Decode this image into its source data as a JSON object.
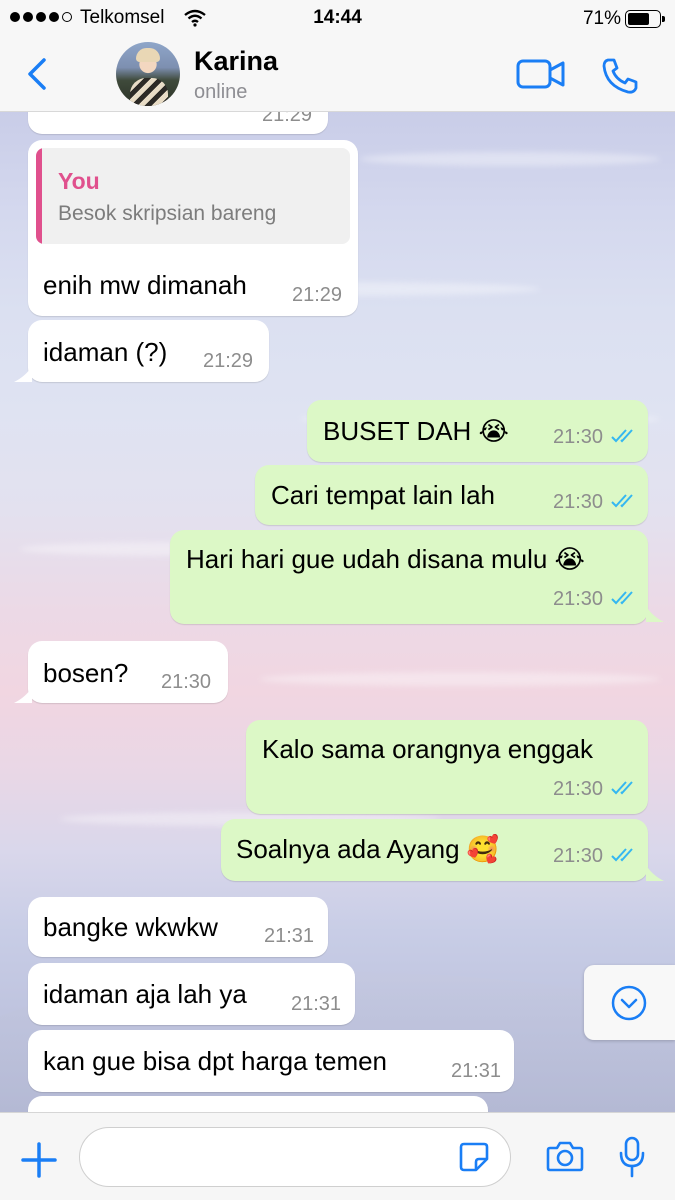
{
  "status_bar": {
    "carrier": "Telkomsel",
    "time": "14:44",
    "battery": "71%"
  },
  "header": {
    "contact_name": "Karina",
    "contact_status": "online",
    "icons": [
      "back-chevron-icon",
      "video-camera-icon",
      "phone-icon"
    ]
  },
  "messages": [
    {
      "dir": "in",
      "time": "21:29",
      "partial": true
    },
    {
      "dir": "in",
      "quote_author": "You",
      "quote_text": "Besok skripsian bareng",
      "text": "enih mw dimanah",
      "time": "21:29"
    },
    {
      "dir": "in",
      "text": "idaman (?)",
      "time": "21:29"
    },
    {
      "dir": "out",
      "text": "BUSET DAH 😭",
      "time": "21:30",
      "status": "read"
    },
    {
      "dir": "out",
      "text": "Cari tempat lain lah",
      "time": "21:30",
      "status": "read"
    },
    {
      "dir": "out",
      "text": "Hari hari gue udah disana mulu 😭",
      "time": "21:30",
      "status": "read"
    },
    {
      "dir": "in",
      "text": "bosen?",
      "time": "21:30"
    },
    {
      "dir": "out",
      "text": "Kalo sama orangnya enggak",
      "time": "21:30",
      "status": "read"
    },
    {
      "dir": "out",
      "text": "Soalnya ada Ayang 🥰",
      "time": "21:30",
      "status": "read"
    },
    {
      "dir": "in",
      "text": "bangke wkwkw",
      "time": "21:31"
    },
    {
      "dir": "in",
      "text": "idaman aja lah ya",
      "time": "21:31"
    },
    {
      "dir": "in",
      "text": "kan gue bisa dpt harga temen",
      "time": "21:31"
    },
    {
      "dir": "in",
      "partial": true
    }
  ],
  "input_bar": {
    "placeholder": "",
    "icons": [
      "plus-icon",
      "sticker-icon",
      "camera-icon",
      "microphone-icon"
    ]
  },
  "colors": {
    "accent": "#1a7ef5",
    "outgoing_bubble": "#dcf8c6",
    "incoming_bubble": "#ffffff",
    "quote_author": "#e0508d",
    "read_ticks": "#34b7f1"
  }
}
